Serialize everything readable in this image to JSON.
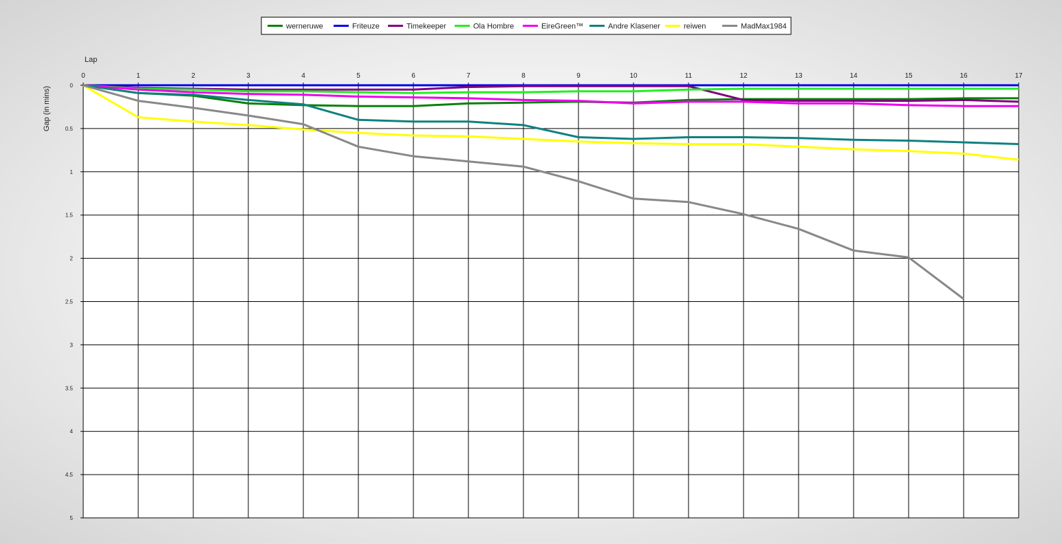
{
  "chart_data": {
    "type": "line",
    "title": "",
    "xlabel": "Lap",
    "ylabel": "Gap (in mins)",
    "y_inverted": true,
    "x_axis_position": "top",
    "grid": true,
    "legend_position": "top-center",
    "xlim": [
      0,
      17
    ],
    "ylim": [
      0,
      5
    ],
    "x_ticks": [
      0,
      1,
      2,
      3,
      4,
      5,
      6,
      7,
      8,
      9,
      10,
      11,
      12,
      13,
      14,
      15,
      16,
      17
    ],
    "y_ticks": [
      0,
      0.5,
      1,
      1.5,
      2,
      2.5,
      3,
      3.5,
      4,
      4.5,
      5
    ],
    "y_tick_labels": [
      "0",
      "0.5",
      "1",
      "1.5",
      "2",
      "2.5",
      "3",
      "3.5",
      "4",
      "4.5",
      "5"
    ],
    "series": [
      {
        "name": "werneruwe",
        "color": "#0a800a",
        "x": [
          0,
          1,
          2,
          3,
          4,
          5,
          6,
          7,
          8,
          9,
          10,
          11,
          12,
          13,
          14,
          15,
          16,
          17
        ],
        "y": [
          0,
          0.09,
          0.12,
          0.21,
          0.23,
          0.24,
          0.24,
          0.21,
          0.2,
          0.19,
          0.2,
          0.17,
          0.16,
          0.16,
          0.16,
          0.16,
          0.15,
          0.15
        ]
      },
      {
        "name": "Friteuze",
        "color": "#0000ee",
        "x": [
          0,
          1,
          2,
          3,
          4,
          5,
          6,
          7,
          8,
          9,
          10,
          11,
          12,
          13,
          14,
          15,
          16,
          17
        ],
        "y": [
          0,
          0,
          0,
          0,
          0,
          0,
          0,
          0,
          0,
          0,
          0,
          0,
          0,
          0,
          0,
          0,
          0,
          0
        ]
      },
      {
        "name": "Timekeeper",
        "color": "#800080",
        "x": [
          0,
          1,
          2,
          3,
          4,
          5,
          6,
          7,
          8,
          9,
          10,
          11,
          12,
          13,
          14,
          15,
          16,
          17
        ],
        "y": [
          0,
          0.03,
          0.04,
          0.05,
          0.05,
          0.05,
          0.05,
          0.02,
          0.01,
          0.01,
          0.01,
          0.01,
          0.17,
          0.18,
          0.18,
          0.18,
          0.17,
          0.19
        ]
      },
      {
        "name": "Ola Hombre",
        "color": "#22ee22",
        "x": [
          0,
          1,
          2,
          3,
          4,
          5,
          6,
          7,
          8,
          9,
          10,
          11,
          12,
          13,
          14,
          15,
          16,
          17
        ],
        "y": [
          0,
          0.04,
          0.05,
          0.07,
          0.07,
          0.08,
          0.09,
          0.08,
          0.08,
          0.07,
          0.07,
          0.05,
          0.04,
          0.04,
          0.04,
          0.04,
          0.04,
          0.04
        ]
      },
      {
        "name": "EireGreen™",
        "color": "#ee00ee",
        "x": [
          0,
          1,
          2,
          3,
          4,
          5,
          6,
          7,
          8,
          9,
          10,
          11,
          12,
          13,
          14,
          15,
          16,
          17
        ],
        "y": [
          0,
          0.05,
          0.08,
          0.1,
          0.11,
          0.13,
          0.14,
          0.15,
          0.17,
          0.18,
          0.21,
          0.19,
          0.19,
          0.21,
          0.21,
          0.23,
          0.24,
          0.24
        ]
      },
      {
        "name": "Andre Klasener",
        "color": "#108080",
        "x": [
          0,
          1,
          2,
          3,
          4,
          5,
          6,
          7,
          8,
          9,
          10,
          11,
          12,
          13,
          14,
          15,
          16,
          17
        ],
        "y": [
          0,
          0.09,
          0.11,
          0.17,
          0.22,
          0.4,
          0.42,
          0.42,
          0.46,
          0.6,
          0.62,
          0.6,
          0.6,
          0.61,
          0.63,
          0.64,
          0.66,
          0.68
        ]
      },
      {
        "name": "reiwen",
        "color": "#ffff00",
        "x": [
          0,
          1,
          2,
          3,
          4,
          5,
          6,
          7,
          8,
          9,
          10,
          11,
          12,
          13,
          14,
          15,
          16,
          17
        ],
        "y": [
          0,
          0.37,
          0.42,
          0.46,
          0.51,
          0.55,
          0.58,
          0.59,
          0.62,
          0.65,
          0.67,
          0.68,
          0.68,
          0.71,
          0.74,
          0.76,
          0.79,
          0.86
        ]
      },
      {
        "name": "MadMax1984",
        "color": "#888888",
        "x": [
          0,
          1,
          2,
          3,
          4,
          5,
          6,
          7,
          8,
          9,
          10,
          11,
          12,
          13,
          14,
          15,
          16
        ],
        "y": [
          0,
          0.18,
          0.26,
          0.35,
          0.45,
          0.71,
          0.82,
          0.88,
          0.94,
          1.11,
          1.31,
          1.35,
          1.49,
          1.66,
          1.91,
          1.99,
          2.47
        ]
      }
    ]
  }
}
